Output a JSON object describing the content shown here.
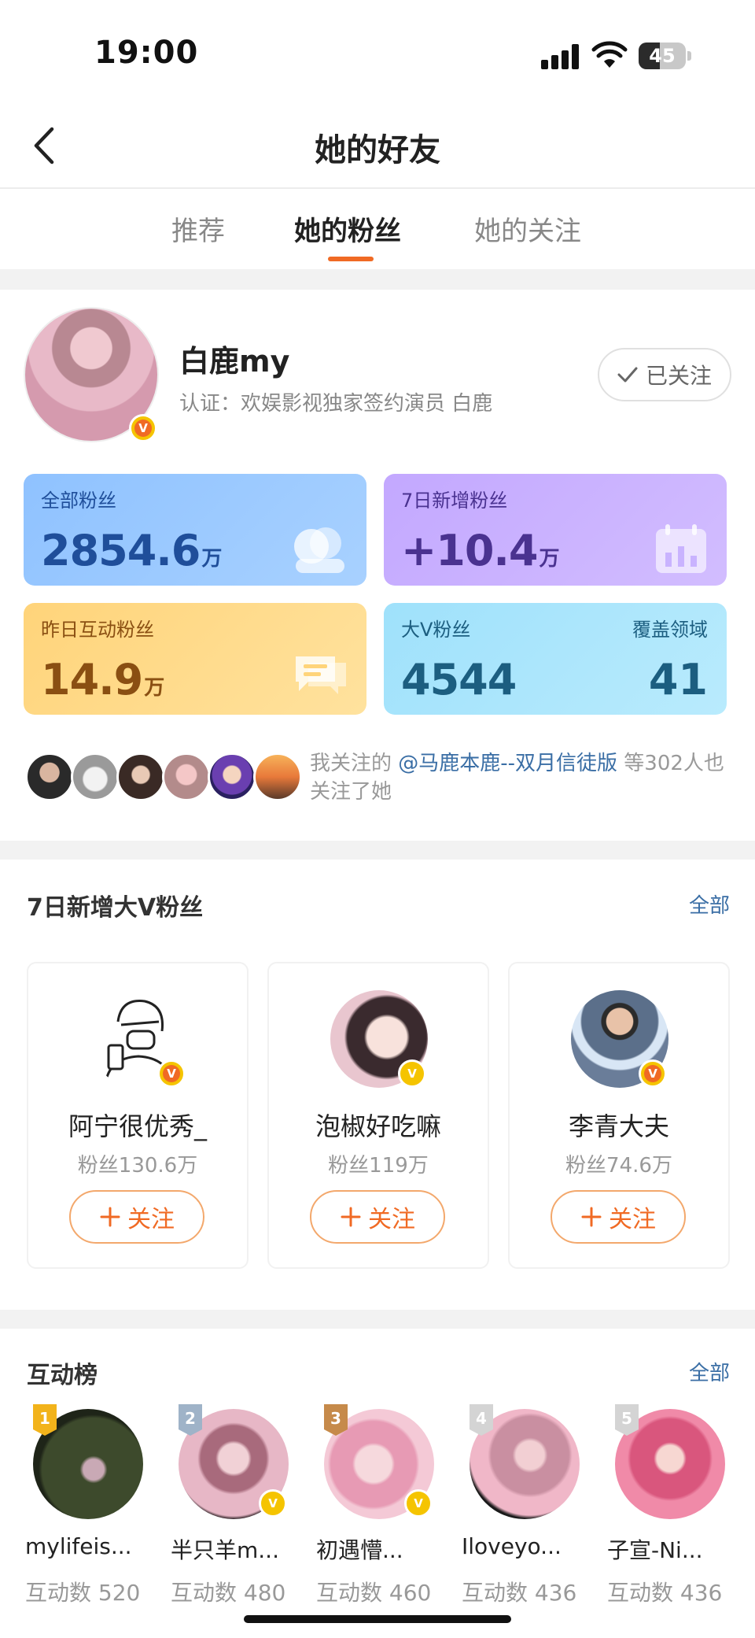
{
  "status_bar": {
    "time": "19:00",
    "battery": "45"
  },
  "nav": {
    "title": "她的好友"
  },
  "tabs": [
    {
      "label": "推荐",
      "active": false
    },
    {
      "label": "她的粉丝",
      "active": true
    },
    {
      "label": "她的关注",
      "active": false
    }
  ],
  "profile": {
    "name": "白鹿my",
    "certification": "认证：欢娱影视独家签约演员 白鹿",
    "follow_status": "已关注"
  },
  "stats": {
    "total_fans": {
      "label": "全部粉丝",
      "value": "2854.6",
      "unit": "万"
    },
    "new_7d": {
      "label": "7日新增粉丝",
      "value": "+10.4",
      "unit": "万"
    },
    "yesterday_active": {
      "label": "昨日互动粉丝",
      "value": "14.9",
      "unit": "万"
    },
    "big_v": {
      "label": "大V粉丝",
      "value": "4544",
      "coverage_label": "覆盖领域",
      "coverage_value": "41"
    }
  },
  "mutual": {
    "prefix": "我关注的 ",
    "link": "@马鹿本鹿--双月信徒版",
    "suffix": " 等302人也关注了她"
  },
  "new_v_fans": {
    "title": "7日新增大V粉丝",
    "more": "全部",
    "follow_label": "关注",
    "items": [
      {
        "name": "阿宁很优秀_",
        "fans": "粉丝130.6万"
      },
      {
        "name": "泡椒好吃嘛",
        "fans": "粉丝119万"
      },
      {
        "name": "李青大夫",
        "fans": "粉丝74.6万"
      }
    ]
  },
  "ranking": {
    "title": "互动榜",
    "more": "全部",
    "items": [
      {
        "rank": "1",
        "name": "mylifeis...",
        "count": "互动数 520"
      },
      {
        "rank": "2",
        "name": "半只羊m...",
        "count": "互动数 480"
      },
      {
        "rank": "3",
        "name": "初遇懵...",
        "count": "互动数 460"
      },
      {
        "rank": "4",
        "name": "Iloveyo...",
        "count": "互动数 436"
      },
      {
        "rank": "5",
        "name": "子宣-Ni...",
        "count": "互动数 436"
      }
    ]
  },
  "colors": {
    "accent": "#f06a24",
    "link": "#3a6ea5"
  }
}
